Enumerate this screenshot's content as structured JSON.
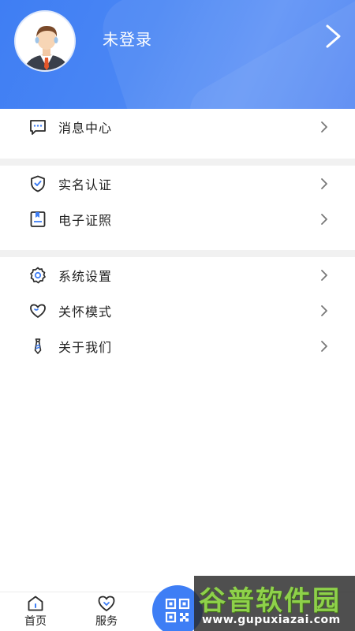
{
  "profile": {
    "login_status": "未登录",
    "avatar_icon": "user-avatar-icon"
  },
  "menu_groups": [
    {
      "items": [
        {
          "label": "消息中心",
          "icon": "message-icon"
        }
      ]
    },
    {
      "items": [
        {
          "label": "实名认证",
          "icon": "shield-check-icon"
        },
        {
          "label": "电子证照",
          "icon": "id-card-icon"
        }
      ]
    },
    {
      "items": [
        {
          "label": "系统设置",
          "icon": "gear-icon"
        },
        {
          "label": "关怀模式",
          "icon": "heart-icon"
        },
        {
          "label": "关于我们",
          "icon": "tie-icon"
        }
      ]
    }
  ],
  "tabbar": {
    "tabs": [
      {
        "label": "首页",
        "icon": "home-icon"
      },
      {
        "label": "服务",
        "icon": "service-heart-icon"
      }
    ],
    "scan_icon": "qr-code-icon"
  },
  "watermark": {
    "title": "谷普软件园",
    "url": "www.gupuxiazai.com"
  },
  "colors": {
    "brand_blue": "#3e7ef5",
    "header_blue": "#4a86f4",
    "divider_gray": "#f1f1f1",
    "watermark_green": "#8ed14a"
  }
}
